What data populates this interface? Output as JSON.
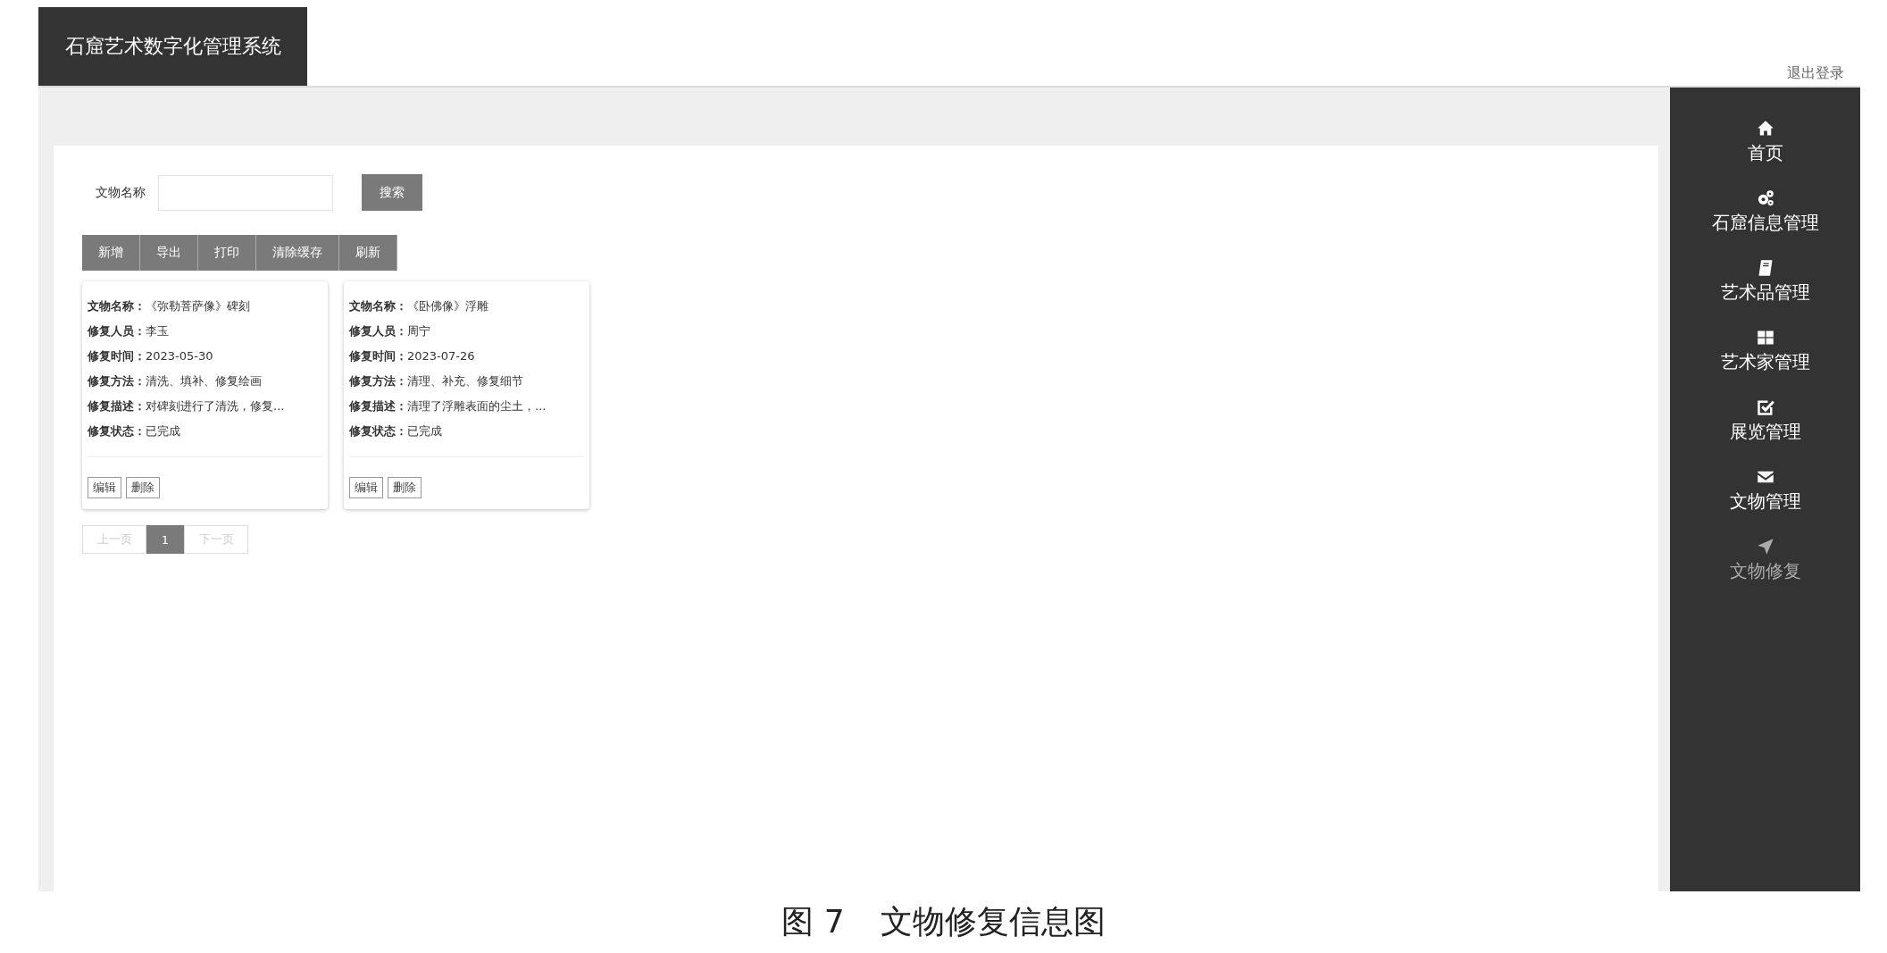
{
  "header": {
    "title": "石窟艺术数字化管理系统",
    "logout": "退出登录"
  },
  "search": {
    "label": "文物名称",
    "button": "搜索"
  },
  "toolbar": [
    "新增",
    "导出",
    "打印",
    "清除缓存",
    "刷新"
  ],
  "cards": [
    {
      "fields": [
        {
          "label": "文物名称：",
          "value": "《弥勒菩萨像》碑刻"
        },
        {
          "label": "修复人员：",
          "value": "李玉"
        },
        {
          "label": "修复时间：",
          "value": "2023-05-30"
        },
        {
          "label": "修复方法：",
          "value": "清洗、填补、修复绘画"
        },
        {
          "label": "修复描述：",
          "value": "对碑刻进行了清洗，修复..."
        },
        {
          "label": "修复状态：",
          "value": "已完成"
        }
      ],
      "actions": [
        "编辑",
        "删除"
      ]
    },
    {
      "fields": [
        {
          "label": "文物名称：",
          "value": "《卧佛像》浮雕"
        },
        {
          "label": "修复人员：",
          "value": "周宁"
        },
        {
          "label": "修复时间：",
          "value": "2023-07-26"
        },
        {
          "label": "修复方法：",
          "value": "清理、补充、修复细节"
        },
        {
          "label": "修复描述：",
          "value": "清理了浮雕表面的尘土，..."
        },
        {
          "label": "修复状态：",
          "value": "已完成"
        }
      ],
      "actions": [
        "编辑",
        "删除"
      ]
    }
  ],
  "pagination": [
    {
      "label": "上一页",
      "selected": false,
      "disabled": true
    },
    {
      "label": "1",
      "selected": true,
      "disabled": false
    },
    {
      "label": "下一页",
      "selected": false,
      "disabled": true
    }
  ],
  "sidebar": {
    "items": [
      {
        "label": "首页",
        "kind": "home",
        "selected": false
      },
      {
        "label": "石窟信息管理",
        "kind": "gears",
        "selected": false
      },
      {
        "label": "艺术品管理",
        "kind": "book",
        "selected": false
      },
      {
        "label": "艺术家管理",
        "kind": "grid",
        "selected": false
      },
      {
        "label": "展览管理",
        "kind": "check",
        "selected": false
      },
      {
        "label": "文物管理",
        "kind": "mail",
        "selected": false
      },
      {
        "label": "文物修复",
        "kind": "send",
        "selected": true
      }
    ]
  },
  "caption": {
    "number": "图 7",
    "title": "文物修复信息图"
  }
}
